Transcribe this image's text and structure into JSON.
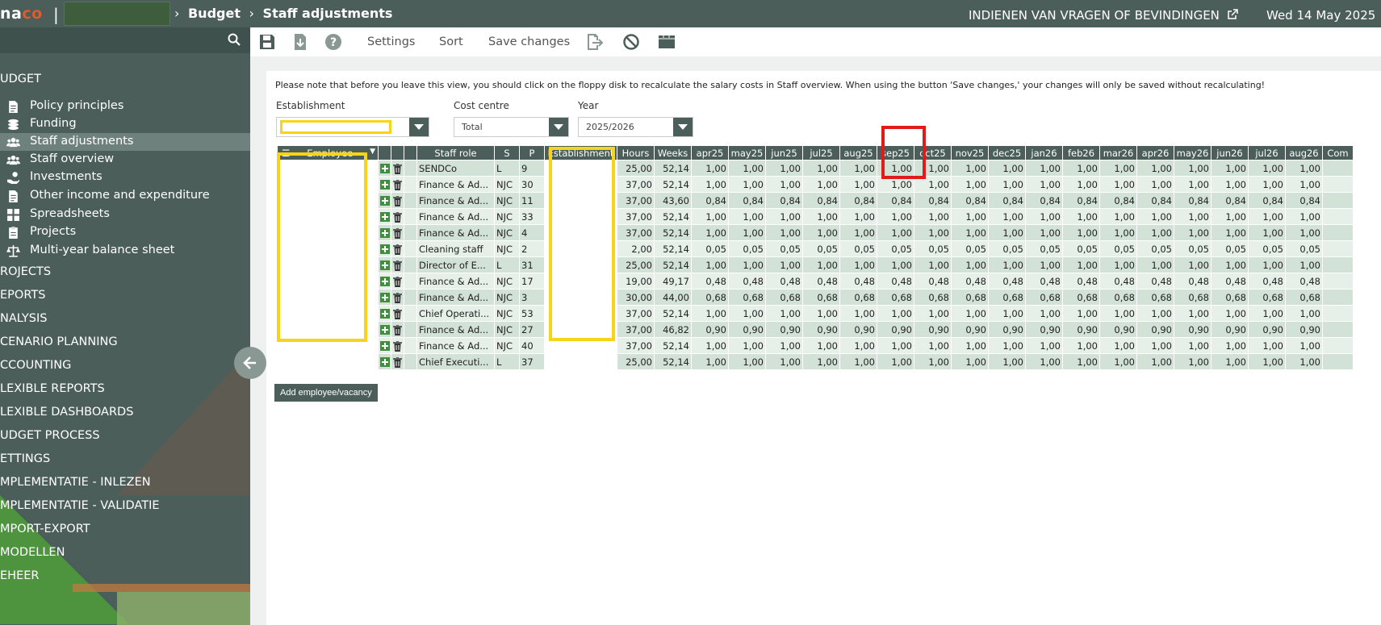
{
  "topbar": {
    "logo": "naco",
    "crumbs": [
      "Budget",
      "Staff adjustments"
    ],
    "feedback": "INDIENEN VAN VRAGEN OF BEVINDINGEN",
    "date": "Wed 14 May 2025"
  },
  "sidebar": {
    "group": "UDGET",
    "items": [
      {
        "label": "Policy principles",
        "icon": "file-icon"
      },
      {
        "label": "Funding",
        "icon": "coins-icon"
      },
      {
        "label": "Staff adjustments",
        "icon": "users-icon",
        "active": true
      },
      {
        "label": "Staff overview",
        "icon": "users-icon"
      },
      {
        "label": "Investments",
        "icon": "hand-coin-icon"
      },
      {
        "label": "Other income and expenditure",
        "icon": "file-icon"
      },
      {
        "label": "Spreadsheets",
        "icon": "grid-icon"
      },
      {
        "label": "Projects",
        "icon": "clipboard-icon"
      },
      {
        "label": "Multi-year balance sheet",
        "icon": "scale-icon"
      }
    ],
    "sections": [
      "ROJECTS",
      "EPORTS",
      "NALYSIS",
      "CENARIO PLANNING",
      "CCOUNTING",
      "LEXIBLE REPORTS",
      "LEXIBLE DASHBOARDS",
      "UDGET PROCESS",
      "ETTINGS",
      "MPLEMENTATIE - INLEZEN",
      "MPLEMENTATIE - VALIDATIE",
      "MPORT-EXPORT",
      "MODELLEN",
      "EHEER"
    ]
  },
  "toolbar": {
    "settings": "Settings",
    "sort": "Sort",
    "save_changes": "Save changes"
  },
  "notice": "Please note that before you leave this view, you should click on the floppy disk to recalculate the salary costs in Staff overview. When using the button 'Save changes,' your changes will only be saved without recalculating!",
  "filters": {
    "establishment_label": "Establishment",
    "establishment_value": "",
    "cost_centre_label": "Cost centre",
    "cost_centre_value": "Total",
    "year_label": "Year",
    "year_value": "2025/2026"
  },
  "grid": {
    "headers": {
      "employee": "Employee",
      "staff_role": "Staff role",
      "s": "S",
      "p": "P",
      "establishment": "Establishment",
      "hours": "Hours",
      "weeks": "Weeks",
      "months": [
        "apr25",
        "may25",
        "jun25",
        "jul25",
        "aug25",
        "sep25",
        "oct25",
        "nov25",
        "dec25",
        "jan26",
        "feb26",
        "mar26",
        "apr26",
        "may26",
        "jun26",
        "jul26",
        "aug26"
      ],
      "com": "Com"
    },
    "rows": [
      {
        "role": "SENDCo",
        "s": "L",
        "p": "9",
        "hours": "25,00",
        "weeks": "52,14",
        "fte": "1,00"
      },
      {
        "role": "Finance & Ad...",
        "s": "NJC",
        "p": "30",
        "hours": "37,00",
        "weeks": "52,14",
        "fte": "1,00"
      },
      {
        "role": "Finance & Ad...",
        "s": "NJC",
        "p": "11",
        "hours": "37,00",
        "weeks": "43,60",
        "fte": "0,84"
      },
      {
        "role": "Finance & Ad...",
        "s": "NJC",
        "p": "33",
        "hours": "37,00",
        "weeks": "52,14",
        "fte": "1,00"
      },
      {
        "role": "Finance & Ad...",
        "s": "NJC",
        "p": "4",
        "hours": "37,00",
        "weeks": "52,14",
        "fte": "1,00"
      },
      {
        "role": "Cleaning staff",
        "s": "NJC",
        "p": "2",
        "hours": "2,00",
        "weeks": "52,14",
        "fte": "0,05"
      },
      {
        "role": "Director of E...",
        "s": "L",
        "p": "31",
        "hours": "25,00",
        "weeks": "52,14",
        "fte": "1,00"
      },
      {
        "role": "Finance & Ad...",
        "s": "NJC",
        "p": "17",
        "hours": "19,00",
        "weeks": "49,17",
        "fte": "0,48"
      },
      {
        "role": "Finance & Ad...",
        "s": "NJC",
        "p": "3",
        "hours": "30,00",
        "weeks": "44,00",
        "fte": "0,68"
      },
      {
        "role": "Chief Operati...",
        "s": "NJC",
        "p": "53",
        "hours": "37,00",
        "weeks": "52,14",
        "fte": "1,00"
      },
      {
        "role": "Finance & Ad...",
        "s": "NJC",
        "p": "27",
        "hours": "37,00",
        "weeks": "46,82",
        "fte": "0,90"
      },
      {
        "role": "Finance & Ad...",
        "s": "NJC",
        "p": "40",
        "hours": "37,00",
        "weeks": "52,14",
        "fte": "1,00"
      },
      {
        "role": "Chief Executi...",
        "s": "L",
        "p": "37",
        "hours": "25,00",
        "weeks": "52,14",
        "fte": "1,00"
      }
    ]
  },
  "add_button": "Add employee/vacancy",
  "colors": {
    "primary": "#4b5e59",
    "highlight_yellow": "#f7d417",
    "highlight_red": "#e01b1b"
  }
}
